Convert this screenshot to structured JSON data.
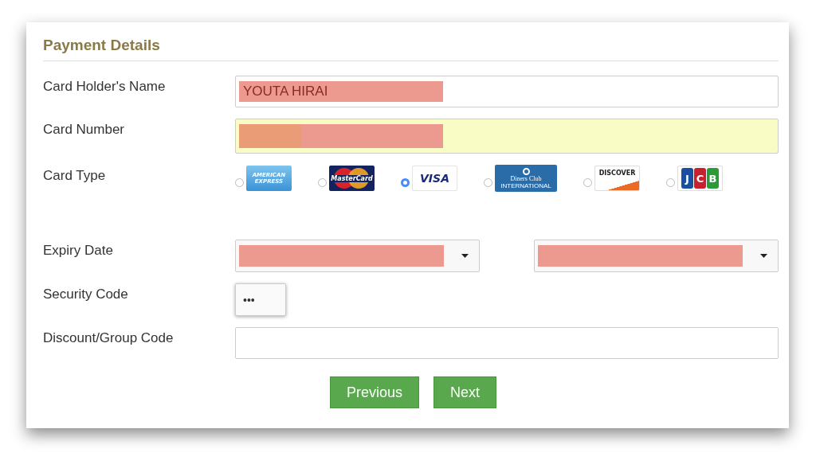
{
  "section_title": "Payment Details",
  "card_holder": {
    "label": "Card Holder's Name",
    "value": "YOUTA HIRAI",
    "redacted": true,
    "highlighted": false
  },
  "card_number": {
    "label": "Card Number",
    "redacted": true,
    "highlighted": true
  },
  "card_type": {
    "label": "Card Type",
    "options": [
      {
        "kind": "amex",
        "lines": [
          "AMERICAN",
          "EXPRESS"
        ],
        "selected": false
      },
      {
        "kind": "mastercard",
        "lines": [
          "MasterCard"
        ],
        "selected": false
      },
      {
        "kind": "visa",
        "lines": [
          "VISA"
        ],
        "selected": true
      },
      {
        "kind": "diners",
        "lines": [
          "Diners Club",
          "INTERNATIONAL"
        ],
        "selected": false
      },
      {
        "kind": "discover",
        "lines": [
          "DISCOVER"
        ],
        "selected": false
      },
      {
        "kind": "jcb",
        "lines": [
          "J",
          "C",
          "B"
        ],
        "selected": false
      }
    ]
  },
  "expiry": {
    "label": "Expiry Date",
    "selects": [
      {
        "redacted": true
      },
      {
        "redacted": true
      }
    ]
  },
  "security_code": {
    "label": "Security Code",
    "value": "•••"
  },
  "discount_code": {
    "label": "Discount/Group Code"
  },
  "buttons": [
    "Previous",
    "Next"
  ]
}
